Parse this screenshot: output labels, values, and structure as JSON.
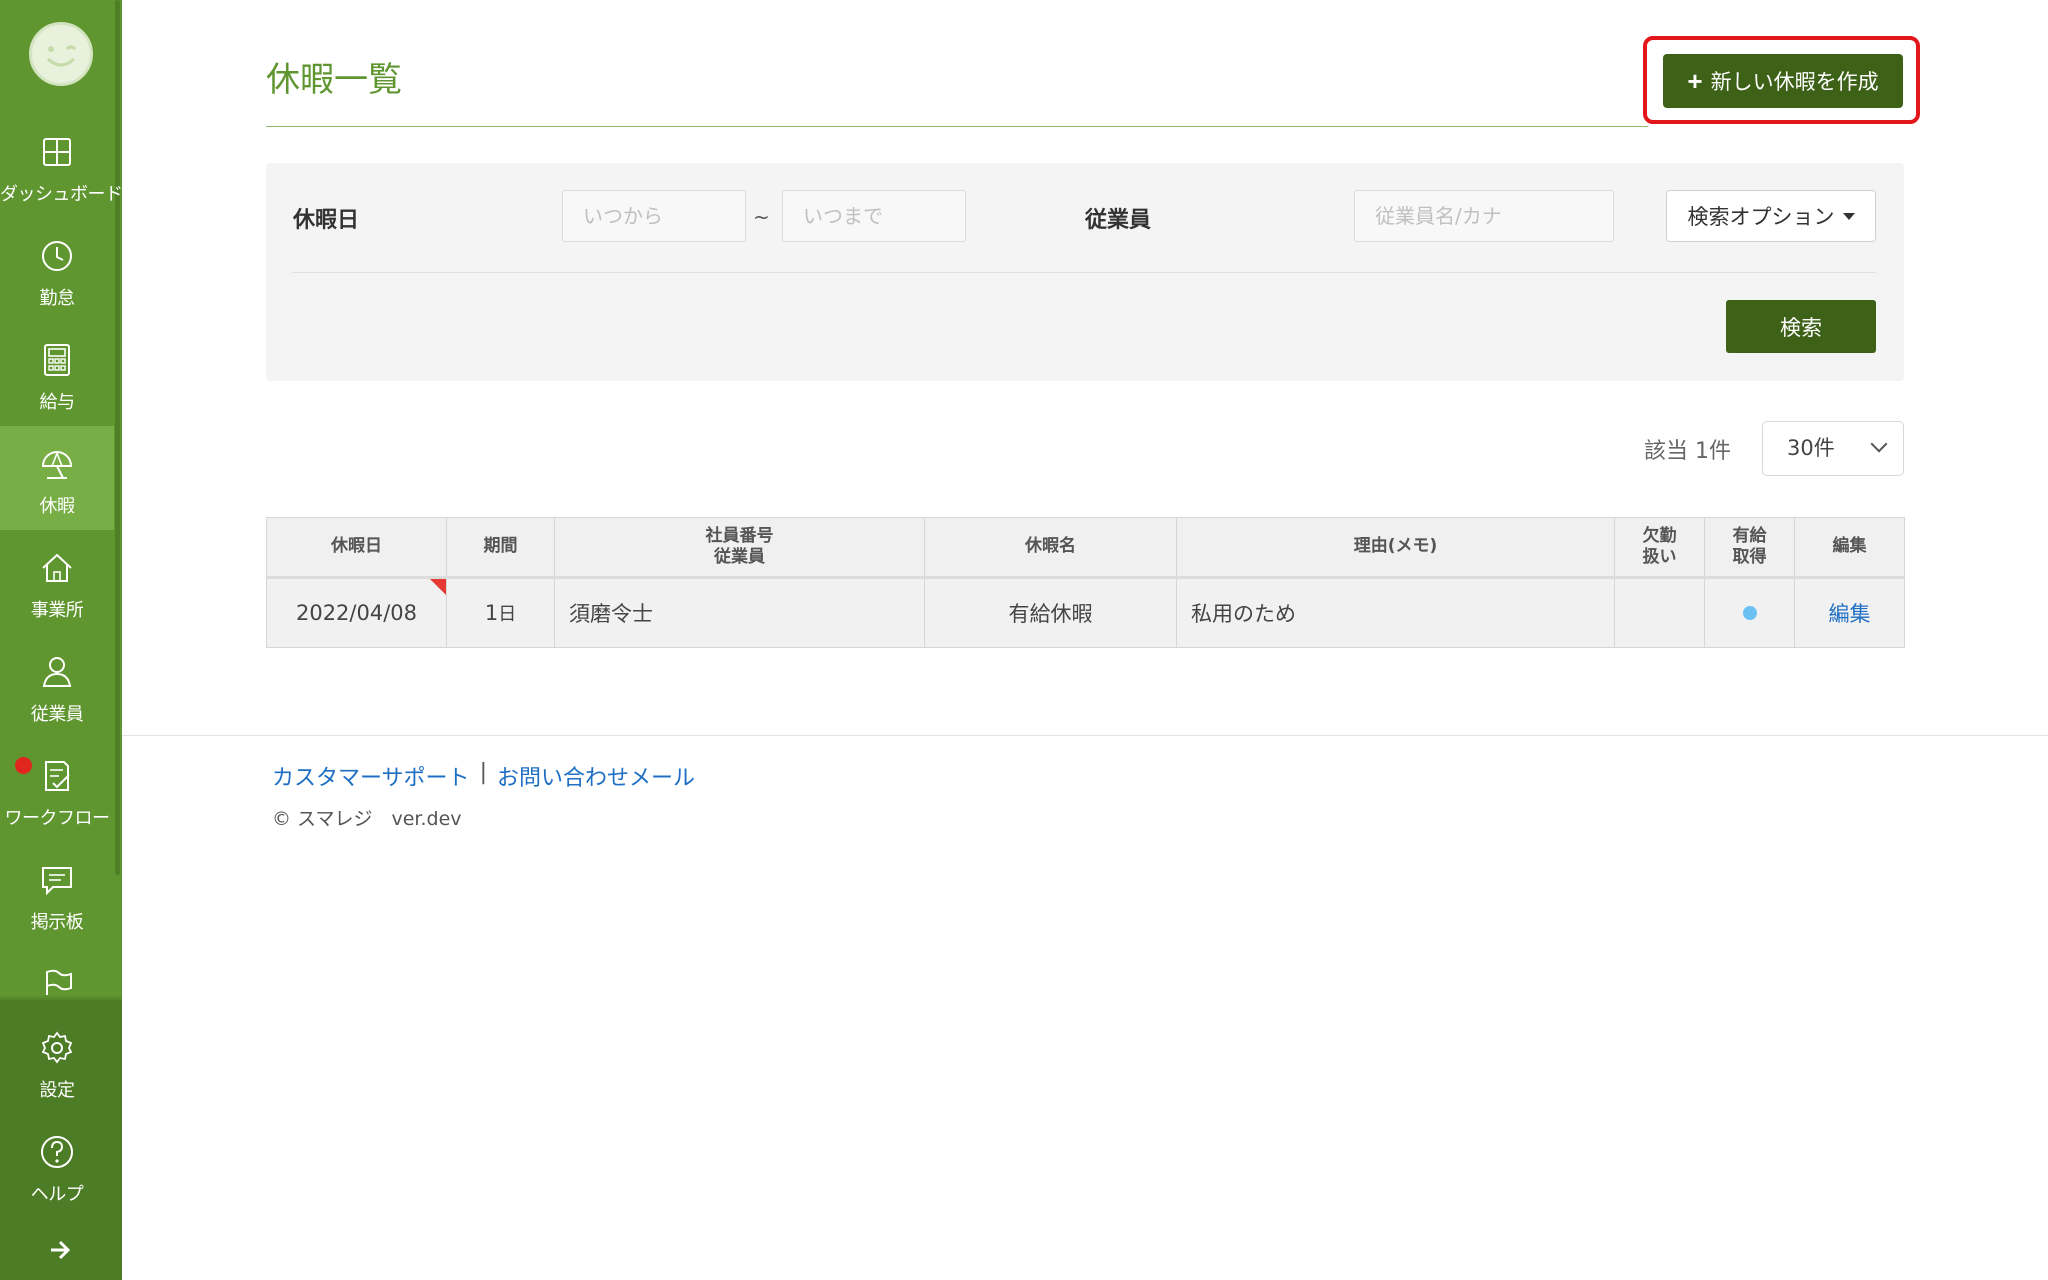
{
  "sidebar": {
    "items": [
      {
        "label": "ダッシュボード",
        "icon": "dashboard-icon"
      },
      {
        "label": "勤怠",
        "icon": "clock-icon"
      },
      {
        "label": "給与",
        "icon": "calculator-icon"
      },
      {
        "label": "休暇",
        "icon": "umbrella-icon",
        "active": true
      },
      {
        "label": "事業所",
        "icon": "home-icon"
      },
      {
        "label": "従業員",
        "icon": "person-icon"
      },
      {
        "label": "ワークフロー",
        "icon": "checklist-icon"
      },
      {
        "label": "掲示板",
        "icon": "chat-icon"
      },
      {
        "label": "",
        "icon": "flag-icon"
      },
      {
        "label": "設定",
        "icon": "gear-icon"
      },
      {
        "label": "ヘルプ",
        "icon": "help-icon"
      }
    ]
  },
  "header": {
    "title": "休暇一覧",
    "new_button": "新しい休暇を作成"
  },
  "filter": {
    "date_label": "休暇日",
    "from_placeholder": "いつから",
    "tilde": "~",
    "to_placeholder": "いつまで",
    "employee_label": "従業員",
    "employee_placeholder": "従業員名/カナ",
    "options_button": "検索オプション",
    "search_button": "検索"
  },
  "results": {
    "count": "該当 1件",
    "per_page": "30件"
  },
  "table": {
    "headers": {
      "date": "休暇日",
      "period": "期間",
      "emp_no": "社員番号",
      "employee": "従業員",
      "type": "休暇名",
      "reason": "理由(メモ)",
      "absence_1": "欠勤",
      "absence_2": "扱い",
      "paid_1": "有給",
      "paid_2": "取得",
      "edit": "編集"
    },
    "rows": [
      {
        "date": "2022/04/08",
        "period_num": "1",
        "period_unit": "日",
        "employee": "須磨令士",
        "type": "有給休暇",
        "reason": "私用のため",
        "absence": "",
        "paid": true,
        "edit": "編集"
      }
    ]
  },
  "footer": {
    "support": "カスタマーサポート",
    "separator": "|",
    "mail": "お問い合わせメール",
    "copyright": "© スマレジ　ver.dev"
  },
  "colors": {
    "sidebar": "#5f9630",
    "primary_button": "#3c6117",
    "highlight": "#e3161b",
    "link": "#1e6fc4"
  }
}
